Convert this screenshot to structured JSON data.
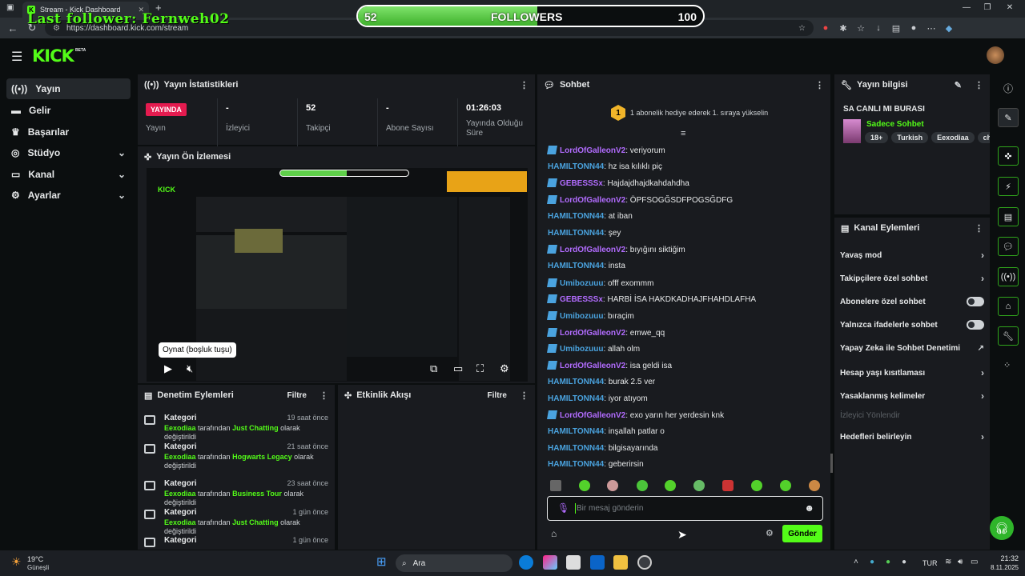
{
  "browser": {
    "tab_title": "Stream - Kick Dashboard",
    "url": "https://dashboard.kick.com/stream"
  },
  "overlay": {
    "last_follower": "Last follower: Fernweh02",
    "followers_current": "52",
    "followers_label": "FOLLOWERS",
    "followers_goal": "100",
    "progress_fraction": 0.52
  },
  "app": {
    "logo": "KICK",
    "logo_tag": "BETA"
  },
  "sidebar": {
    "items": [
      {
        "label": "Yayın",
        "icon": "broadcast-icon"
      },
      {
        "label": "Gelir",
        "icon": "money-icon"
      },
      {
        "label": "Başarılar",
        "icon": "trophy-icon"
      },
      {
        "label": "Stüdyo",
        "icon": "studio-icon"
      },
      {
        "label": "Kanal",
        "icon": "channel-icon"
      },
      {
        "label": "Ayarlar",
        "icon": "gear-icon"
      }
    ]
  },
  "stats": {
    "title": "Yayın İstatistikleri",
    "items": [
      {
        "value": "YAYINDA",
        "label": "Yayın"
      },
      {
        "value": "-",
        "label": "İzleyici"
      },
      {
        "value": "52",
        "label": "Takipçi"
      },
      {
        "value": "-",
        "label": "Abone Sayısı"
      },
      {
        "value": "01:26:03",
        "label": "Yayında Olduğu Süre"
      }
    ]
  },
  "preview": {
    "title": "Yayın Ön İzlemesi",
    "tooltip": "Oynat (boşluk tuşu)"
  },
  "moderation": {
    "title": "Denetim Eylemleri",
    "filter": "Filtre",
    "items": [
      {
        "title": "Kategori",
        "time": "19 saat önce",
        "user": "Eexodiaa",
        "mid": " tarafından ",
        "cat": "Just Chatting",
        "end": " olarak değiştirildi"
      },
      {
        "title": "Kategori",
        "time": "21 saat önce",
        "user": "Eexodiaa",
        "mid": " tarafından ",
        "cat": "Hogwarts Legacy",
        "end": " olarak değiştirildi"
      },
      {
        "title": "Kategori",
        "time": "23 saat önce",
        "user": "Eexodiaa",
        "mid": " tarafından ",
        "cat": "Business Tour",
        "end": " olarak değiştirildi"
      },
      {
        "title": "Kategori",
        "time": "1 gün önce",
        "user": "Eexodiaa",
        "mid": " tarafından ",
        "cat": "Just Chatting",
        "end": " olarak değiştirildi"
      },
      {
        "title": "Kategori",
        "time": "1 gün önce",
        "user": "",
        "mid": "",
        "cat": "",
        "end": ""
      }
    ]
  },
  "activity": {
    "title": "Etkinlik Akışı",
    "filter": "Filtre"
  },
  "chat": {
    "title": "Sohbet",
    "pinned_rank": "1",
    "pinned_text": "1 abonelik hediye ederek 1. sıraya yükselin",
    "messages": [
      {
        "user": "LordOfGalleonV2",
        "color": "#b26cff",
        "sub": true,
        "text": "veriyorum"
      },
      {
        "user": "HAMILTONN44",
        "color": "#4aa3df",
        "sub": false,
        "text": "hz isa kılıklı piç"
      },
      {
        "user": "GEBESSSx",
        "color": "#b26cff",
        "sub": true,
        "text": "Hajdajdhajdkahdahdha"
      },
      {
        "user": "LordOfGalleonV2",
        "color": "#b26cff",
        "sub": true,
        "text": "ÖPFSOGĞSDFPOGSĞDFG"
      },
      {
        "user": "HAMILTONN44",
        "color": "#4aa3df",
        "sub": false,
        "text": "at iban"
      },
      {
        "user": "HAMILTONN44",
        "color": "#4aa3df",
        "sub": false,
        "text": "şey"
      },
      {
        "user": "LordOfGalleonV2",
        "color": "#b26cff",
        "sub": true,
        "text": "bıyığını siktiğim"
      },
      {
        "user": "HAMILTONN44",
        "color": "#4aa3df",
        "sub": false,
        "text": "insta"
      },
      {
        "user": "Umibozuuu",
        "color": "#4aa3df",
        "sub": true,
        "text": "offf exommm"
      },
      {
        "user": "GEBESSSx",
        "color": "#b26cff",
        "sub": true,
        "text": "HARBİ İSA HAKDKADHAJFHAHDLAFHA"
      },
      {
        "user": "Umibozuuu",
        "color": "#4aa3df",
        "sub": true,
        "text": "bıraçim"
      },
      {
        "user": "LordOfGalleonV2",
        "color": "#b26cff",
        "sub": true,
        "text": "emwe_qq"
      },
      {
        "user": "Umibozuuu",
        "color": "#4aa3df",
        "sub": true,
        "text": "allah olm"
      },
      {
        "user": "LordOfGalleonV2",
        "color": "#b26cff",
        "sub": true,
        "text": "isa geldi isa"
      },
      {
        "user": "HAMILTONN44",
        "color": "#4aa3df",
        "sub": false,
        "text": "burak 2.5 ver"
      },
      {
        "user": "HAMILTONN44",
        "color": "#4aa3df",
        "sub": false,
        "text": "iyor atıyom"
      },
      {
        "user": "LordOfGalleonV2",
        "color": "#b26cff",
        "sub": true,
        "text": "exo yarın her yerdesin knk"
      },
      {
        "user": "HAMILTONN44",
        "color": "#4aa3df",
        "sub": false,
        "text": "inşallah patlar o"
      },
      {
        "user": "HAMILTONN44",
        "color": "#4aa3df",
        "sub": false,
        "text": "bilgisayarında"
      },
      {
        "user": "HAMILTONN44",
        "color": "#4aa3df",
        "sub": false,
        "text": "geberirsin"
      }
    ],
    "input_placeholder": "Bir mesaj gönderin",
    "send": "Gönder"
  },
  "stream_info": {
    "title": "Yayın bilgisi",
    "stream_title": "SA CANLI MI BURASI",
    "category": "Sadece Sohbet",
    "tags": [
      "18+",
      "Turkish",
      "Eexodiaa",
      "chi"
    ]
  },
  "channel_actions": {
    "title": "Kanal Eylemleri",
    "items": [
      {
        "label": "Yavaş mod",
        "kind": "arrow"
      },
      {
        "label": "Takipçilere özel sohbet",
        "kind": "arrow"
      },
      {
        "label": "Abonelere özel sohbet",
        "kind": "toggle"
      },
      {
        "label": "Yalnızca ifadelerle sohbet",
        "kind": "toggle"
      },
      {
        "label": "Yapay Zeka ile Sohbet Denetimi",
        "kind": "ext"
      },
      {
        "label": "Hesap yaşı kısıtlaması",
        "kind": "arrow"
      },
      {
        "label": "Yasaklanmış kelimeler",
        "kind": "arrow"
      },
      {
        "label": "İzleyici Yönlendir",
        "kind": "disabled"
      },
      {
        "label": "Hedefleri belirleyin",
        "kind": "arrow"
      }
    ]
  },
  "taskbar": {
    "temp": "19°C",
    "weather": "Güneşli",
    "search": "Ara",
    "lang": "TUR",
    "time": "21:32",
    "date": "8.11.2025"
  },
  "colors": {
    "accent": "#53fc18",
    "live": "#e41b4f"
  }
}
